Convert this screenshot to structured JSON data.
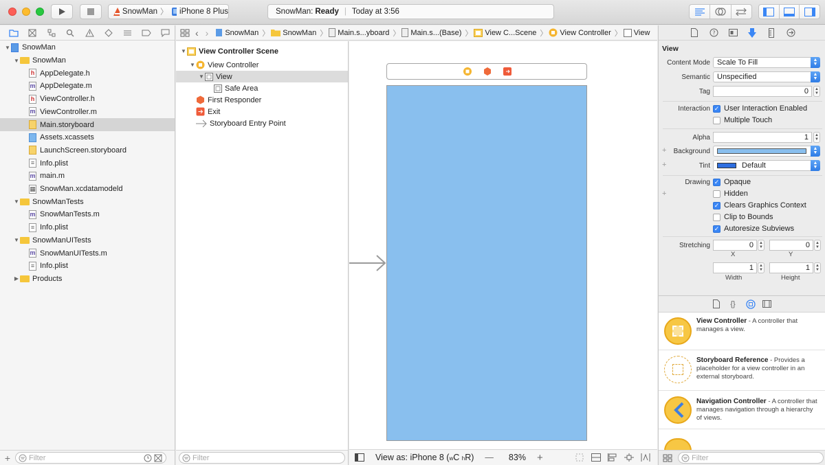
{
  "toolbar": {
    "scheme_target": "SnowMan",
    "scheme_device": "iPhone 8 Plus",
    "status_app": "SnowMan:",
    "status_state": "Ready",
    "status_time": "Today at 3:56"
  },
  "navigator": {
    "tree": [
      {
        "label": "SnowMan",
        "kind": "project",
        "depth": 0,
        "open": true
      },
      {
        "label": "SnowMan",
        "kind": "folder",
        "depth": 1,
        "open": true
      },
      {
        "label": "AppDelegate.h",
        "kind": "h",
        "depth": 2
      },
      {
        "label": "AppDelegate.m",
        "kind": "m",
        "depth": 2
      },
      {
        "label": "ViewController.h",
        "kind": "h",
        "depth": 2
      },
      {
        "label": "ViewController.m",
        "kind": "m",
        "depth": 2
      },
      {
        "label": "Main.storyboard",
        "kind": "sb",
        "depth": 2,
        "selected": true
      },
      {
        "label": "Assets.xcassets",
        "kind": "xa",
        "depth": 2
      },
      {
        "label": "LaunchScreen.storyboard",
        "kind": "sb",
        "depth": 2
      },
      {
        "label": "Info.plist",
        "kind": "pl",
        "depth": 2
      },
      {
        "label": "main.m",
        "kind": "m",
        "depth": 2
      },
      {
        "label": "SnowMan.xcdatamodeld",
        "kind": "dm",
        "depth": 2
      },
      {
        "label": "SnowManTests",
        "kind": "folder",
        "depth": 1,
        "open": true
      },
      {
        "label": "SnowManTests.m",
        "kind": "m",
        "depth": 2
      },
      {
        "label": "Info.plist",
        "kind": "pl",
        "depth": 2
      },
      {
        "label": "SnowManUITests",
        "kind": "folder",
        "depth": 1,
        "open": true
      },
      {
        "label": "SnowManUITests.m",
        "kind": "m",
        "depth": 2
      },
      {
        "label": "Info.plist",
        "kind": "pl",
        "depth": 2
      },
      {
        "label": "Products",
        "kind": "folder",
        "depth": 1,
        "open": false
      }
    ],
    "filter_placeholder": "Filter"
  },
  "jumpbar": {
    "crumbs": [
      "SnowMan",
      "SnowMan",
      "Main.s...yboard",
      "Main.s...(Base)",
      "View C...Scene",
      "View Controller",
      "View"
    ]
  },
  "outline": {
    "rows": [
      {
        "label": "View Controller Scene",
        "depth": 0,
        "bold": true,
        "icon": "scene",
        "open": true
      },
      {
        "label": "View Controller",
        "depth": 1,
        "icon": "vc",
        "open": true
      },
      {
        "label": "View",
        "depth": 2,
        "icon": "view",
        "open": true,
        "selected": true
      },
      {
        "label": "Safe Area",
        "depth": 3,
        "icon": "view"
      },
      {
        "label": "First Responder",
        "depth": 1,
        "icon": "responder"
      },
      {
        "label": "Exit",
        "depth": 1,
        "icon": "exit"
      },
      {
        "label": "Storyboard Entry Point",
        "depth": 1,
        "icon": "arrow"
      }
    ],
    "filter_placeholder": "Filter"
  },
  "canvas_bar": {
    "view_as_prefix": "View as: iPhone 8 (",
    "size_w": "w",
    "size_wc": "C ",
    "size_h": "h",
    "size_hr": "R)",
    "minus": "—",
    "zoom": "83%",
    "plus": "+"
  },
  "inspector": {
    "section_title": "View",
    "content_mode_label": "Content Mode",
    "content_mode_value": "Scale To Fill",
    "semantic_label": "Semantic",
    "semantic_value": "Unspecified",
    "tag_label": "Tag",
    "tag_value": "0",
    "interaction_label": "Interaction",
    "user_interaction": "User Interaction Enabled",
    "multiple_touch": "Multiple Touch",
    "alpha_label": "Alpha",
    "alpha_value": "1",
    "background_label": "Background",
    "background_color": "#89bfee",
    "tint_label": "Tint",
    "tint_value": "Default",
    "tint_color": "#2f6fe0",
    "drawing_label": "Drawing",
    "opaque": "Opaque",
    "hidden": "Hidden",
    "clears_graphics": "Clears Graphics Context",
    "clip_bounds": "Clip to Bounds",
    "autoresize": "Autoresize Subviews",
    "stretching_label": "Stretching",
    "stretch_x": "0",
    "stretch_y": "0",
    "stretch_x_label": "X",
    "stretch_y_label": "Y",
    "stretch_w": "1",
    "stretch_h": "1",
    "stretch_w_label": "Width",
    "stretch_h_label": "Height",
    "plus_sign": "+"
  },
  "library": {
    "items": [
      {
        "title": "View Controller",
        "desc": " - A controller that manages a view."
      },
      {
        "title": "Storyboard Reference",
        "desc": " - Provides a placeholder for a view controller in an external storyboard."
      },
      {
        "title": "Navigation Controller",
        "desc": " - A controller that manages navigation through a hierarchy of views."
      }
    ],
    "filter_placeholder": "Filter"
  },
  "colors": {
    "accent": "#3a86f5",
    "canvas_view": "#89bfee",
    "folder": "#f5c63b"
  }
}
